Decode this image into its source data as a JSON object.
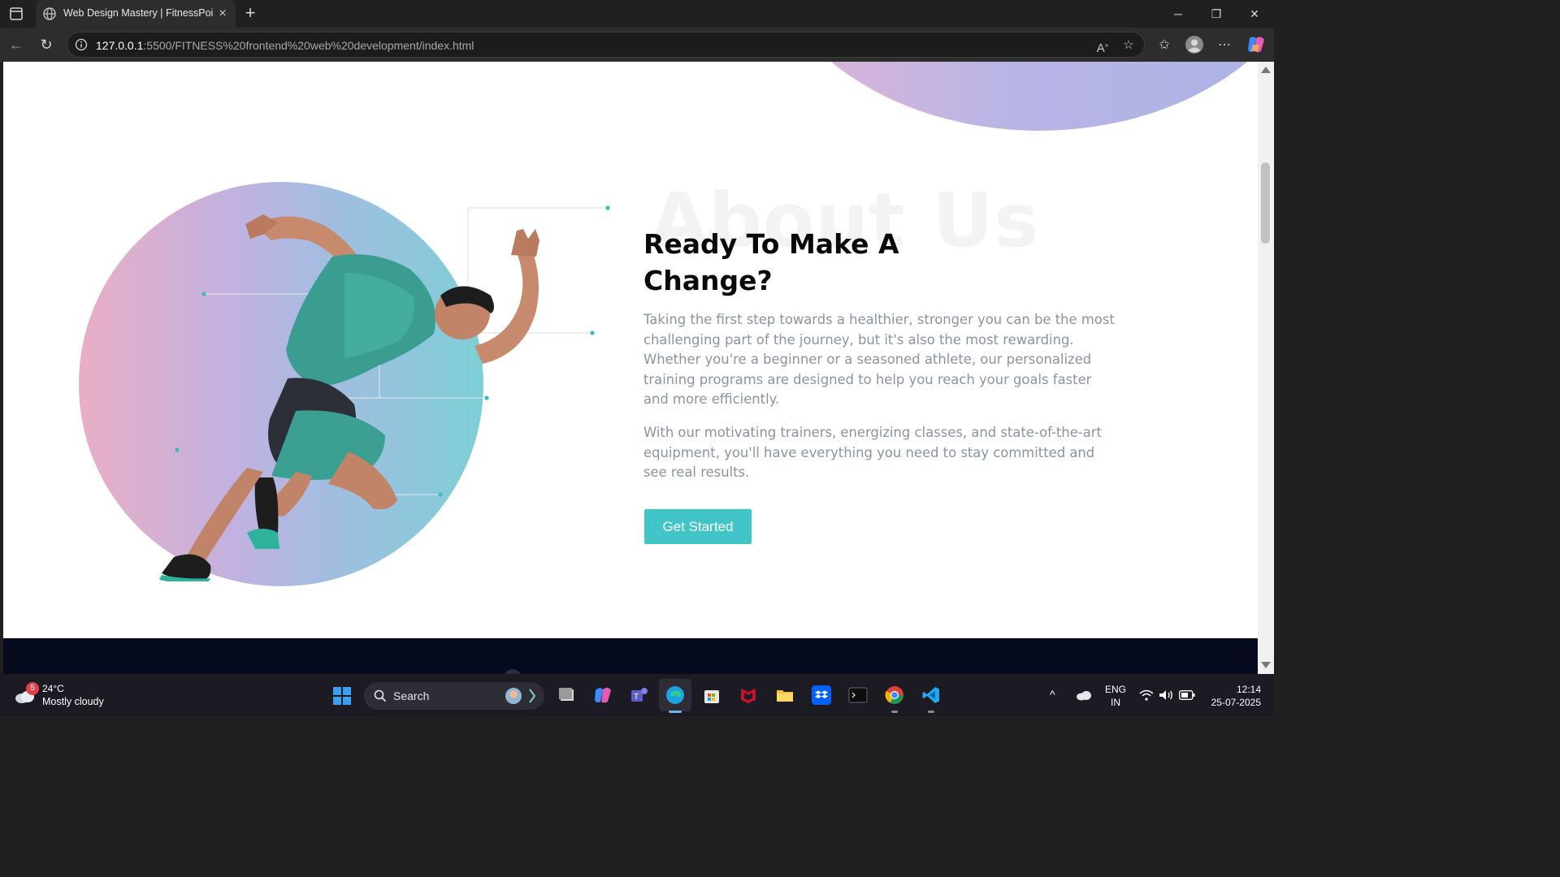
{
  "browser": {
    "tab_title": "Web Design Mastery | FitnessPoint",
    "url_host": "127.0.0.1",
    "url_rest": ":5500/FITNESS%20frontend%20web%20development/index.html"
  },
  "page": {
    "watermark": "About Us",
    "heading": "Ready To Make A Change?",
    "paragraph1": "Taking the first step towards a healthier, stronger you can be the most challenging part of the journey, but it's also the most rewarding. Whether you're a beginner or a seasoned athlete, our personalized training programs are designed to help you reach your goals faster and more efficiently.",
    "paragraph2": "With our motivating trainers, energizing classes, and state-of-the-art equipment, you'll have everything you need to stay committed and see real results.",
    "cta_label": "Get Started"
  },
  "colors": {
    "accent": "#41c5c8",
    "heading": "#0a0a0a",
    "body_text": "#8a93a3",
    "footer": "#050a1c"
  },
  "taskbar": {
    "weather_badge": "5",
    "weather_temp": "24°C",
    "weather_desc": "Mostly cloudy",
    "search_label": "Search",
    "lang_top": "ENG",
    "lang_bottom": "IN",
    "time": "12:14",
    "date": "25-07-2025"
  }
}
